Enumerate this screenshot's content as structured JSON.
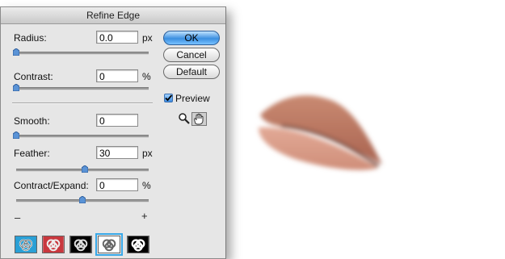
{
  "dialog": {
    "title": "Refine Edge",
    "radius": {
      "label": "Radius:",
      "value": "0.0",
      "unit": "px",
      "slider": 0.0
    },
    "contrast": {
      "label": "Contrast:",
      "value": "0",
      "unit": "%",
      "slider": 0.0
    },
    "smooth": {
      "label": "Smooth:",
      "value": "0",
      "slider": 0.0
    },
    "feather": {
      "label": "Feather:",
      "value": "30",
      "unit": "px",
      "slider": 0.52
    },
    "contract_expand": {
      "label": "Contract/Expand:",
      "value": "0",
      "unit": "%",
      "slider": 0.5,
      "min_symbol": "–",
      "max_symbol": "+"
    },
    "buttons": {
      "ok": "OK",
      "cancel": "Cancel",
      "default": "Default"
    },
    "preview": {
      "label": "Preview",
      "checked": true
    },
    "tools": [
      "zoom-icon",
      "hand-icon"
    ],
    "view_modes": [
      {
        "name": "standard",
        "selected": false
      },
      {
        "name": "quick-mask",
        "selected": false
      },
      {
        "name": "on-black",
        "selected": false
      },
      {
        "name": "on-white",
        "selected": true
      },
      {
        "name": "mask",
        "selected": false
      }
    ]
  },
  "colors": {
    "accent": "#38a8e8",
    "ok_button": "#3b8fe0",
    "dialog_bg": "#e6e6e6"
  }
}
